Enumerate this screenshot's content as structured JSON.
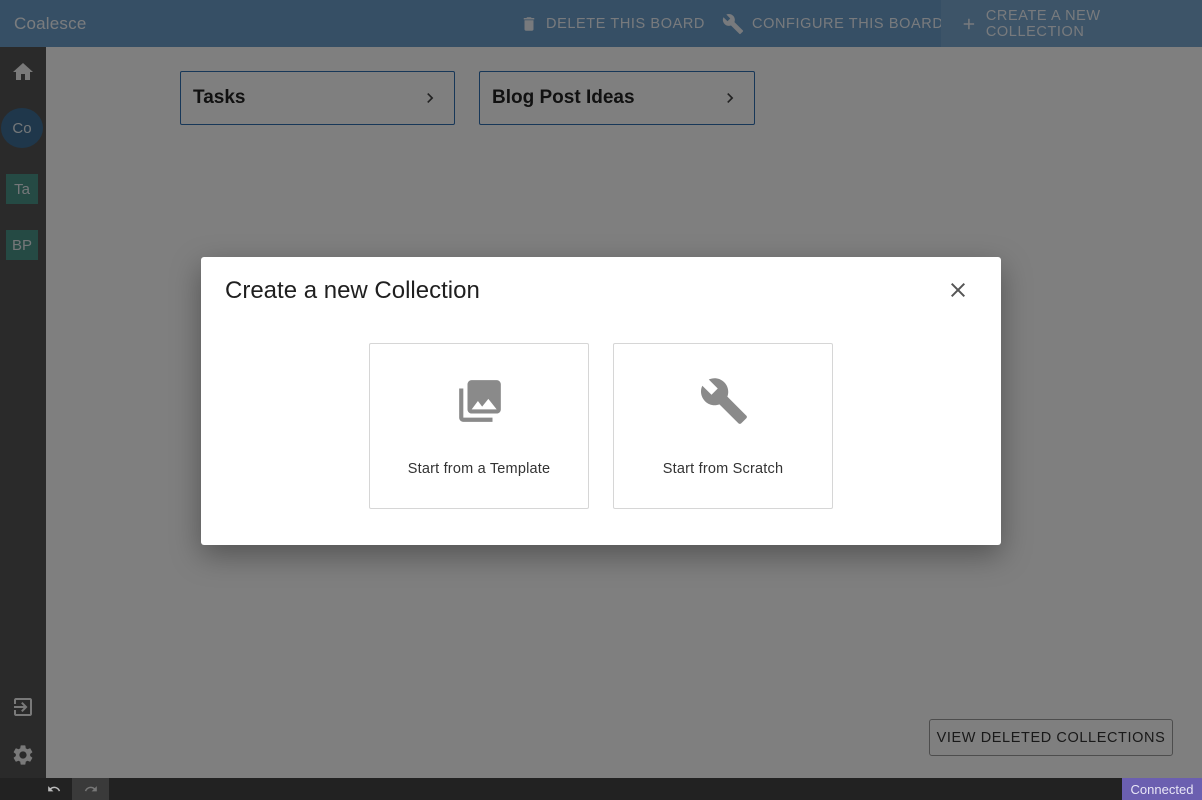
{
  "app": {
    "title": "Coalesce"
  },
  "toolbar": {
    "delete_label": "DELETE THIS BOARD",
    "configure_label": "CONFIGURE THIS BOARD",
    "create_label": "CREATE A NEW COLLECTION",
    "icons": {
      "delete": "trash-icon",
      "configure": "wrench-icon",
      "create": "plus-icon"
    }
  },
  "sidebar": {
    "items": [
      {
        "label": "Co",
        "icon": "avatar"
      },
      {
        "label": "Ta",
        "icon": "avatar"
      },
      {
        "label": "BP",
        "icon": "avatar"
      }
    ],
    "icons": [
      "home-icon",
      "logout-icon",
      "gear-icon"
    ]
  },
  "collections": [
    {
      "title": "Tasks"
    },
    {
      "title": "Blog Post Ideas"
    }
  ],
  "main": {
    "view_deleted_label": "VIEW DELETED COLLECTIONS"
  },
  "dialog": {
    "title": "Create a new Collection",
    "options": [
      {
        "label": "Start from a Template",
        "icon": "photo-library-icon"
      },
      {
        "label": "Start from Scratch",
        "icon": "wrench-icon"
      }
    ]
  },
  "statusbar": {
    "connection": "Connected"
  },
  "colors": {
    "topbar": "#6d9fcb",
    "sidebar": "#545454",
    "accent": "#2f6fb0",
    "avatar_teal": "#4a9488",
    "avatar_blue": "#3e6f97",
    "connected": "#6b5fb0"
  }
}
